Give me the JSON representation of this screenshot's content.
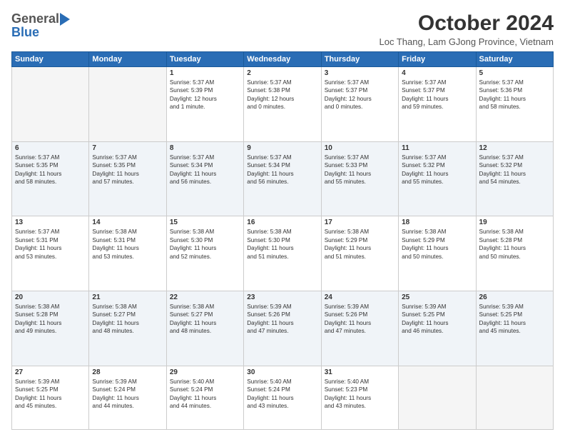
{
  "logo": {
    "general": "General",
    "blue": "Blue"
  },
  "title": "October 2024",
  "location": "Loc Thang, Lam GJong Province, Vietnam",
  "days_header": [
    "Sunday",
    "Monday",
    "Tuesday",
    "Wednesday",
    "Thursday",
    "Friday",
    "Saturday"
  ],
  "weeks": [
    [
      {
        "num": "",
        "info": ""
      },
      {
        "num": "",
        "info": ""
      },
      {
        "num": "1",
        "info": "Sunrise: 5:37 AM\nSunset: 5:39 PM\nDaylight: 12 hours\nand 1 minute."
      },
      {
        "num": "2",
        "info": "Sunrise: 5:37 AM\nSunset: 5:38 PM\nDaylight: 12 hours\nand 0 minutes."
      },
      {
        "num": "3",
        "info": "Sunrise: 5:37 AM\nSunset: 5:37 PM\nDaylight: 12 hours\nand 0 minutes."
      },
      {
        "num": "4",
        "info": "Sunrise: 5:37 AM\nSunset: 5:37 PM\nDaylight: 11 hours\nand 59 minutes."
      },
      {
        "num": "5",
        "info": "Sunrise: 5:37 AM\nSunset: 5:36 PM\nDaylight: 11 hours\nand 58 minutes."
      }
    ],
    [
      {
        "num": "6",
        "info": "Sunrise: 5:37 AM\nSunset: 5:35 PM\nDaylight: 11 hours\nand 58 minutes."
      },
      {
        "num": "7",
        "info": "Sunrise: 5:37 AM\nSunset: 5:35 PM\nDaylight: 11 hours\nand 57 minutes."
      },
      {
        "num": "8",
        "info": "Sunrise: 5:37 AM\nSunset: 5:34 PM\nDaylight: 11 hours\nand 56 minutes."
      },
      {
        "num": "9",
        "info": "Sunrise: 5:37 AM\nSunset: 5:34 PM\nDaylight: 11 hours\nand 56 minutes."
      },
      {
        "num": "10",
        "info": "Sunrise: 5:37 AM\nSunset: 5:33 PM\nDaylight: 11 hours\nand 55 minutes."
      },
      {
        "num": "11",
        "info": "Sunrise: 5:37 AM\nSunset: 5:32 PM\nDaylight: 11 hours\nand 55 minutes."
      },
      {
        "num": "12",
        "info": "Sunrise: 5:37 AM\nSunset: 5:32 PM\nDaylight: 11 hours\nand 54 minutes."
      }
    ],
    [
      {
        "num": "13",
        "info": "Sunrise: 5:37 AM\nSunset: 5:31 PM\nDaylight: 11 hours\nand 53 minutes."
      },
      {
        "num": "14",
        "info": "Sunrise: 5:38 AM\nSunset: 5:31 PM\nDaylight: 11 hours\nand 53 minutes."
      },
      {
        "num": "15",
        "info": "Sunrise: 5:38 AM\nSunset: 5:30 PM\nDaylight: 11 hours\nand 52 minutes."
      },
      {
        "num": "16",
        "info": "Sunrise: 5:38 AM\nSunset: 5:30 PM\nDaylight: 11 hours\nand 51 minutes."
      },
      {
        "num": "17",
        "info": "Sunrise: 5:38 AM\nSunset: 5:29 PM\nDaylight: 11 hours\nand 51 minutes."
      },
      {
        "num": "18",
        "info": "Sunrise: 5:38 AM\nSunset: 5:29 PM\nDaylight: 11 hours\nand 50 minutes."
      },
      {
        "num": "19",
        "info": "Sunrise: 5:38 AM\nSunset: 5:28 PM\nDaylight: 11 hours\nand 50 minutes."
      }
    ],
    [
      {
        "num": "20",
        "info": "Sunrise: 5:38 AM\nSunset: 5:28 PM\nDaylight: 11 hours\nand 49 minutes."
      },
      {
        "num": "21",
        "info": "Sunrise: 5:38 AM\nSunset: 5:27 PM\nDaylight: 11 hours\nand 48 minutes."
      },
      {
        "num": "22",
        "info": "Sunrise: 5:38 AM\nSunset: 5:27 PM\nDaylight: 11 hours\nand 48 minutes."
      },
      {
        "num": "23",
        "info": "Sunrise: 5:39 AM\nSunset: 5:26 PM\nDaylight: 11 hours\nand 47 minutes."
      },
      {
        "num": "24",
        "info": "Sunrise: 5:39 AM\nSunset: 5:26 PM\nDaylight: 11 hours\nand 47 minutes."
      },
      {
        "num": "25",
        "info": "Sunrise: 5:39 AM\nSunset: 5:25 PM\nDaylight: 11 hours\nand 46 minutes."
      },
      {
        "num": "26",
        "info": "Sunrise: 5:39 AM\nSunset: 5:25 PM\nDaylight: 11 hours\nand 45 minutes."
      }
    ],
    [
      {
        "num": "27",
        "info": "Sunrise: 5:39 AM\nSunset: 5:25 PM\nDaylight: 11 hours\nand 45 minutes."
      },
      {
        "num": "28",
        "info": "Sunrise: 5:39 AM\nSunset: 5:24 PM\nDaylight: 11 hours\nand 44 minutes."
      },
      {
        "num": "29",
        "info": "Sunrise: 5:40 AM\nSunset: 5:24 PM\nDaylight: 11 hours\nand 44 minutes."
      },
      {
        "num": "30",
        "info": "Sunrise: 5:40 AM\nSunset: 5:24 PM\nDaylight: 11 hours\nand 43 minutes."
      },
      {
        "num": "31",
        "info": "Sunrise: 5:40 AM\nSunset: 5:23 PM\nDaylight: 11 hours\nand 43 minutes."
      },
      {
        "num": "",
        "info": ""
      },
      {
        "num": "",
        "info": ""
      }
    ]
  ]
}
